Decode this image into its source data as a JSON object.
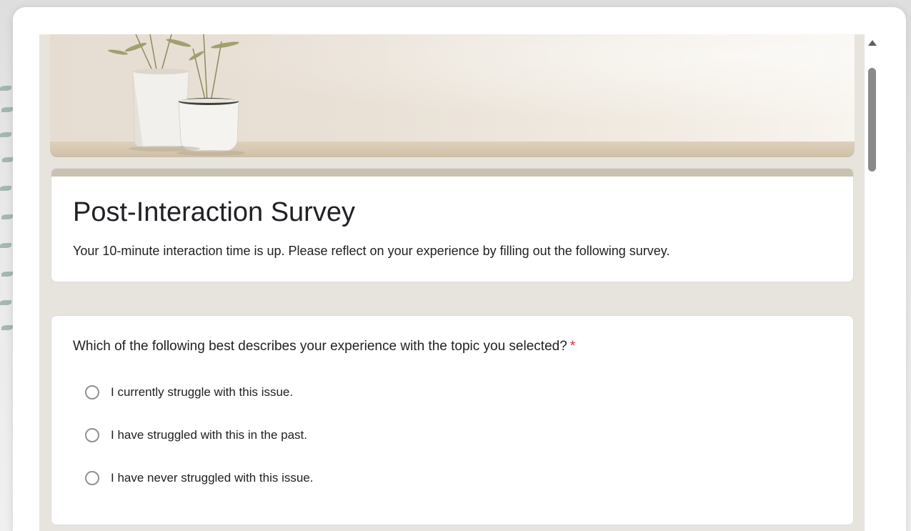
{
  "form": {
    "title": "Post-Interaction Survey",
    "description": "Your 10-minute interaction time is up. Please reflect on your experience by filling out the following survey."
  },
  "question": {
    "text": "Which of the following best describes your experience with the topic you selected?",
    "required_marker": "*",
    "options": [
      {
        "label": "I currently struggle with this issue.",
        "selected": false
      },
      {
        "label": "I have struggled with this in the past.",
        "selected": false
      },
      {
        "label": "I have never struggled with this issue.",
        "selected": false
      }
    ]
  },
  "theme": {
    "accent_color": "#c9c1b1",
    "background_color": "#e7e4dd",
    "required_color": "#d93025"
  },
  "icons": {
    "scroll_up": "triangle-up-icon",
    "radio": "radio-unchecked-icon"
  }
}
